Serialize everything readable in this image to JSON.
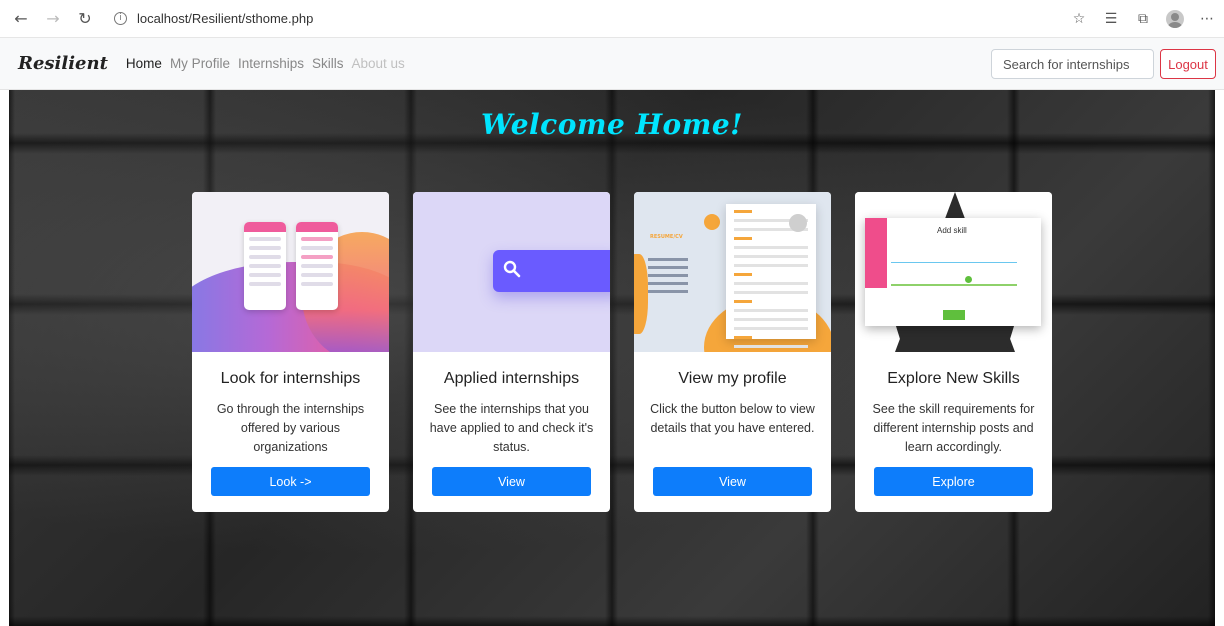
{
  "browser": {
    "url": "localhost/Resilient/sthome.php"
  },
  "navbar": {
    "brand": "Resilient",
    "links": [
      "Home",
      "My Profile",
      "Internships",
      "Skills",
      "About us"
    ],
    "search_placeholder": "Search for internships",
    "logout_label": "Logout"
  },
  "hero": {
    "welcome": "Welcome Home!"
  },
  "cards": [
    {
      "title": "Look for internships",
      "text": "Go through the internships offered by various organizations",
      "button": "Look ->"
    },
    {
      "title": "Applied internships",
      "text": "See the internships that you have applied to and check it's status.",
      "button": "View"
    },
    {
      "title": "View my profile",
      "text": "Click the button below to view details that you have entered.",
      "button": "View"
    },
    {
      "title": "Explore New Skills",
      "text": "See the skill requirements for different internship posts and learn accordingly.",
      "button": "Explore"
    }
  ],
  "illustrations": {
    "resume_label": "RESUME/CV",
    "add_skill_title": "Add skill"
  },
  "colors": {
    "accent": "#0d7dfb",
    "welcome": "#00e5ff",
    "logout": "#dc3545"
  }
}
